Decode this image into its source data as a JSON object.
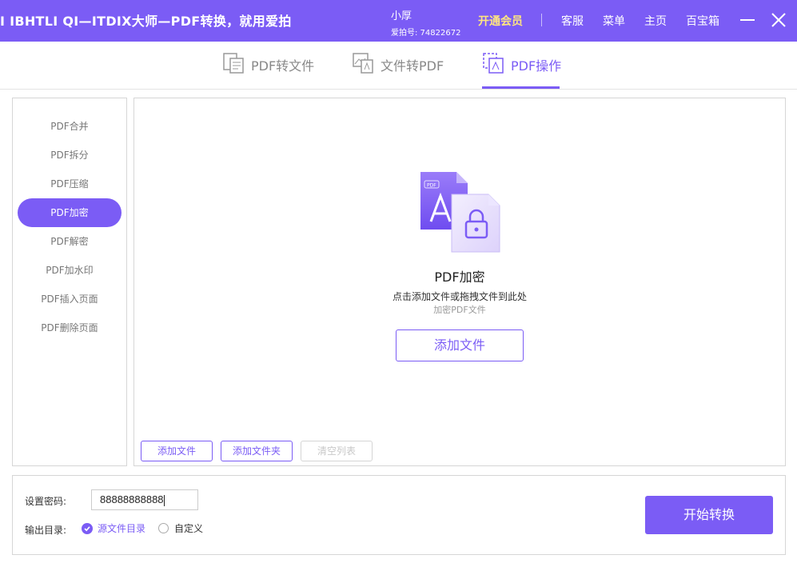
{
  "titlebar": {
    "app_title": "I IBHTLI QI—ITDIX大师—PDF转换，就用爱拍",
    "user_name": "小厚",
    "user_id": "爱拍号: 74822672",
    "vip_label": "开通会员",
    "links": [
      "客服",
      "菜单",
      "主页",
      "百宝箱"
    ]
  },
  "tabs": [
    {
      "label": "PDF转文件",
      "icon": "pdf-to-file-icon"
    },
    {
      "label": "文件转PDF",
      "icon": "file-to-pdf-icon"
    },
    {
      "label": "PDF操作",
      "icon": "pdf-operation-icon",
      "active": true
    }
  ],
  "sidebar": {
    "items": [
      {
        "label": "PDF合并"
      },
      {
        "label": "PDF拆分"
      },
      {
        "label": "PDF压缩"
      },
      {
        "label": "PDF加密",
        "active": true
      },
      {
        "label": "PDF解密"
      },
      {
        "label": "PDF加水印"
      },
      {
        "label": "PDF插入页面"
      },
      {
        "label": "PDF删除页面"
      }
    ]
  },
  "main": {
    "icon": "pdf-lock-icon",
    "title": "PDF加密",
    "hint": "点击添加文件或拖拽文件到此处",
    "subhint": "加密PDF文件",
    "add_file_big": "添加文件",
    "add_file": "添加文件",
    "add_folder": "添加文件夹",
    "clear_list": "清空列表"
  },
  "bottom": {
    "password_label": "设置密码:",
    "password_value": "88888888888",
    "output_label": "输出目录:",
    "option_source": "源文件目录",
    "option_custom": "自定义",
    "selected": "源文件目录",
    "start_button": "开始转换"
  },
  "colors": {
    "accent": "#7b5cf5",
    "vip": "#ffe680"
  }
}
